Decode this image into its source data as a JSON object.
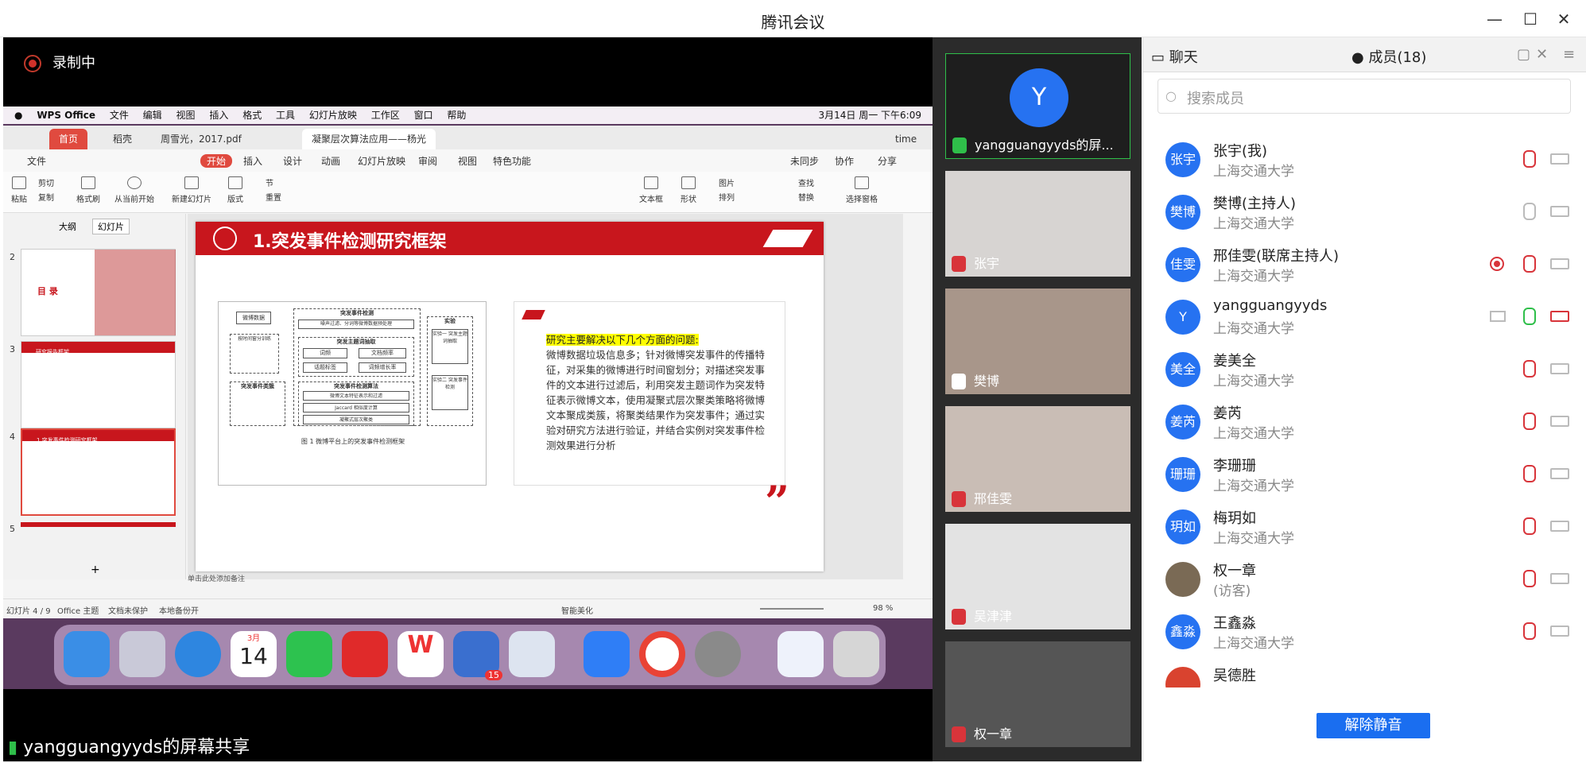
{
  "app": {
    "title": "腾讯会议"
  },
  "share": {
    "recording": "录制中",
    "sharer_label": "yangguangyyds的屏幕共享",
    "menubar": {
      "apple": "",
      "items": [
        "WPS Office",
        "文件",
        "编辑",
        "视图",
        "插入",
        "格式",
        "工具",
        "幻灯片放映",
        "工作区",
        "窗口",
        "帮助"
      ],
      "clock": "3月14日 周一 下午6:09"
    },
    "wps": {
      "tabs": [
        "首页",
        "稻壳",
        "周雪光，2017.pdf",
        "凝聚层次算法应用——杨光"
      ],
      "user": "time",
      "menu": [
        "文件",
        "开始",
        "插入",
        "设计",
        "动画",
        "幻灯片放映",
        "审阅",
        "视图",
        "特色功能"
      ],
      "menu_right": [
        "未同步",
        "协作",
        "分享"
      ],
      "ribbon": [
        "粘贴",
        "剪切",
        "复制",
        "格式刷",
        "从当前开始",
        "新建幻灯片",
        "版式",
        "节",
        "重置",
        "文本框",
        "形状",
        "图片",
        "排列",
        "查找",
        "替换",
        "选择窗格"
      ],
      "panel_tabs": [
        "大纲",
        "幻灯片"
      ],
      "thumb_labels": [
        "2",
        "3",
        "4",
        "5"
      ],
      "thumb_captions": [
        "目 录",
        "研究报告框架",
        "1.突发事件检测研究框架"
      ],
      "slide": {
        "title": "1.突发事件检测研究框架",
        "diagram": {
          "caption": "图 1   微博平台上的突发事件检测框架",
          "labels": {
            "data": "微博数据",
            "filter": "按时间窗分训练",
            "detect": "突发事件检测",
            "preprocess": "噪声过滤、分词等微博数据预处理",
            "topic": "突发主题词抽取",
            "wordfreq": "词频",
            "docfreq": "文档频率",
            "growth": "话题标签",
            "ratio": "词频增长率",
            "alg": "突发事件检测算法",
            "a1": "微博文本特征表示和过滤",
            "a2": "Jaccard 相似度计算",
            "a3": "凝聚式层次聚类",
            "types": "突发事件类簇",
            "exp": "实验",
            "exp1": "实验一 突发主题词抽取",
            "exp2": "实验二 突发事件检测"
          }
        },
        "highlight": "研究主要解决以下几个方面的问题:",
        "body": "微博数据垃圾信息多；针对微博突发事件的传播特征，对采集的微博进行时间窗划分；对描述突发事件的文本进行过滤后，利用突发主题词作为突发特征表示微博文本，使用凝聚式层次聚类策略将微博文本聚成类簇，将聚类结果作为突发事件；通过实验对研究方法进行验证，并结合实例对突发事件检测效果进行分析",
        "notes": "单击此处添加备注"
      },
      "status": {
        "page": "幻灯片 4 / 9",
        "theme": "Office 主题",
        "protect": "文档未保护",
        "backup": "本地备份开",
        "beautify": "智能美化",
        "zoom": "98 %"
      }
    },
    "dock": {
      "calendar_month": "3月",
      "calendar_day": "14",
      "badge": "15"
    }
  },
  "videos": [
    {
      "name": "yangguangyyds的屏...",
      "initial": "Y"
    },
    {
      "name": "张宇"
    },
    {
      "name": "樊博"
    },
    {
      "name": "邢佳雯"
    },
    {
      "name": "吴津津"
    },
    {
      "name": "权一章"
    }
  ],
  "panel": {
    "chat_tab": "聊天",
    "members_tab": "成员(18)",
    "search_placeholder": "搜索成员",
    "members": [
      {
        "avatar": "张宇",
        "name": "张宇(我)",
        "org": "上海交通大学"
      },
      {
        "avatar": "樊博",
        "name": "樊博(主持人)",
        "org": "上海交通大学"
      },
      {
        "avatar": "佳雯",
        "name": "邢佳雯(联席主持人)",
        "org": "上海交通大学"
      },
      {
        "avatar": "Y",
        "name": "yangguangyyds",
        "org": "上海交通大学"
      },
      {
        "avatar": "美全",
        "name": "姜美全",
        "org": "上海交通大学"
      },
      {
        "avatar": "姜芮",
        "name": "姜芮",
        "org": "上海交通大学"
      },
      {
        "avatar": "珊珊",
        "name": "李珊珊",
        "org": "上海交通大学"
      },
      {
        "avatar": "玥如",
        "name": "梅玥如",
        "org": "上海交通大学"
      },
      {
        "avatar": "",
        "name": "权一章",
        "org": "(访客)"
      },
      {
        "avatar": "鑫淼",
        "name": "王鑫淼",
        "org": "上海交通大学"
      },
      {
        "avatar": "",
        "name": "吴德胜",
        "org": ""
      }
    ],
    "unmute_all": "解除静音"
  },
  "colors": {
    "accent": "#2672f1",
    "wps_red": "#c8161d",
    "mic_green": "#2fbf4a",
    "mute_red": "#d8343a"
  }
}
